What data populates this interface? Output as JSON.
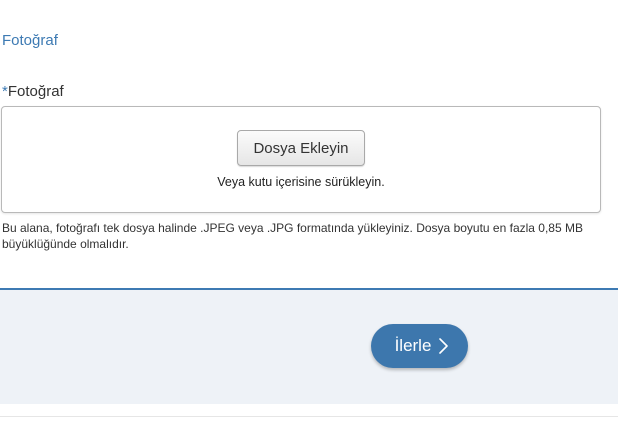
{
  "section": {
    "title": "Fotoğraf"
  },
  "photo_field": {
    "required_marker": "*",
    "label": "Fotoğraf",
    "add_button_label": "Dosya Ekleyin",
    "drop_hint": "Veya kutu içerisine sürükleyin.",
    "help_text": "Bu alana, fotoğrafı tek dosya halinde .JPEG veya .JPG formatında yükleyiniz. Dosya boyutu en fazla 0,85 MB büyüklüğünde olmalıdır."
  },
  "footer": {
    "next_label": "İlerle",
    "next_icon": "chevron-right-icon"
  },
  "colors": {
    "accent": "#3d7ab3",
    "button_primary": "#3d77ad",
    "footer_bg": "#eef2f7"
  }
}
